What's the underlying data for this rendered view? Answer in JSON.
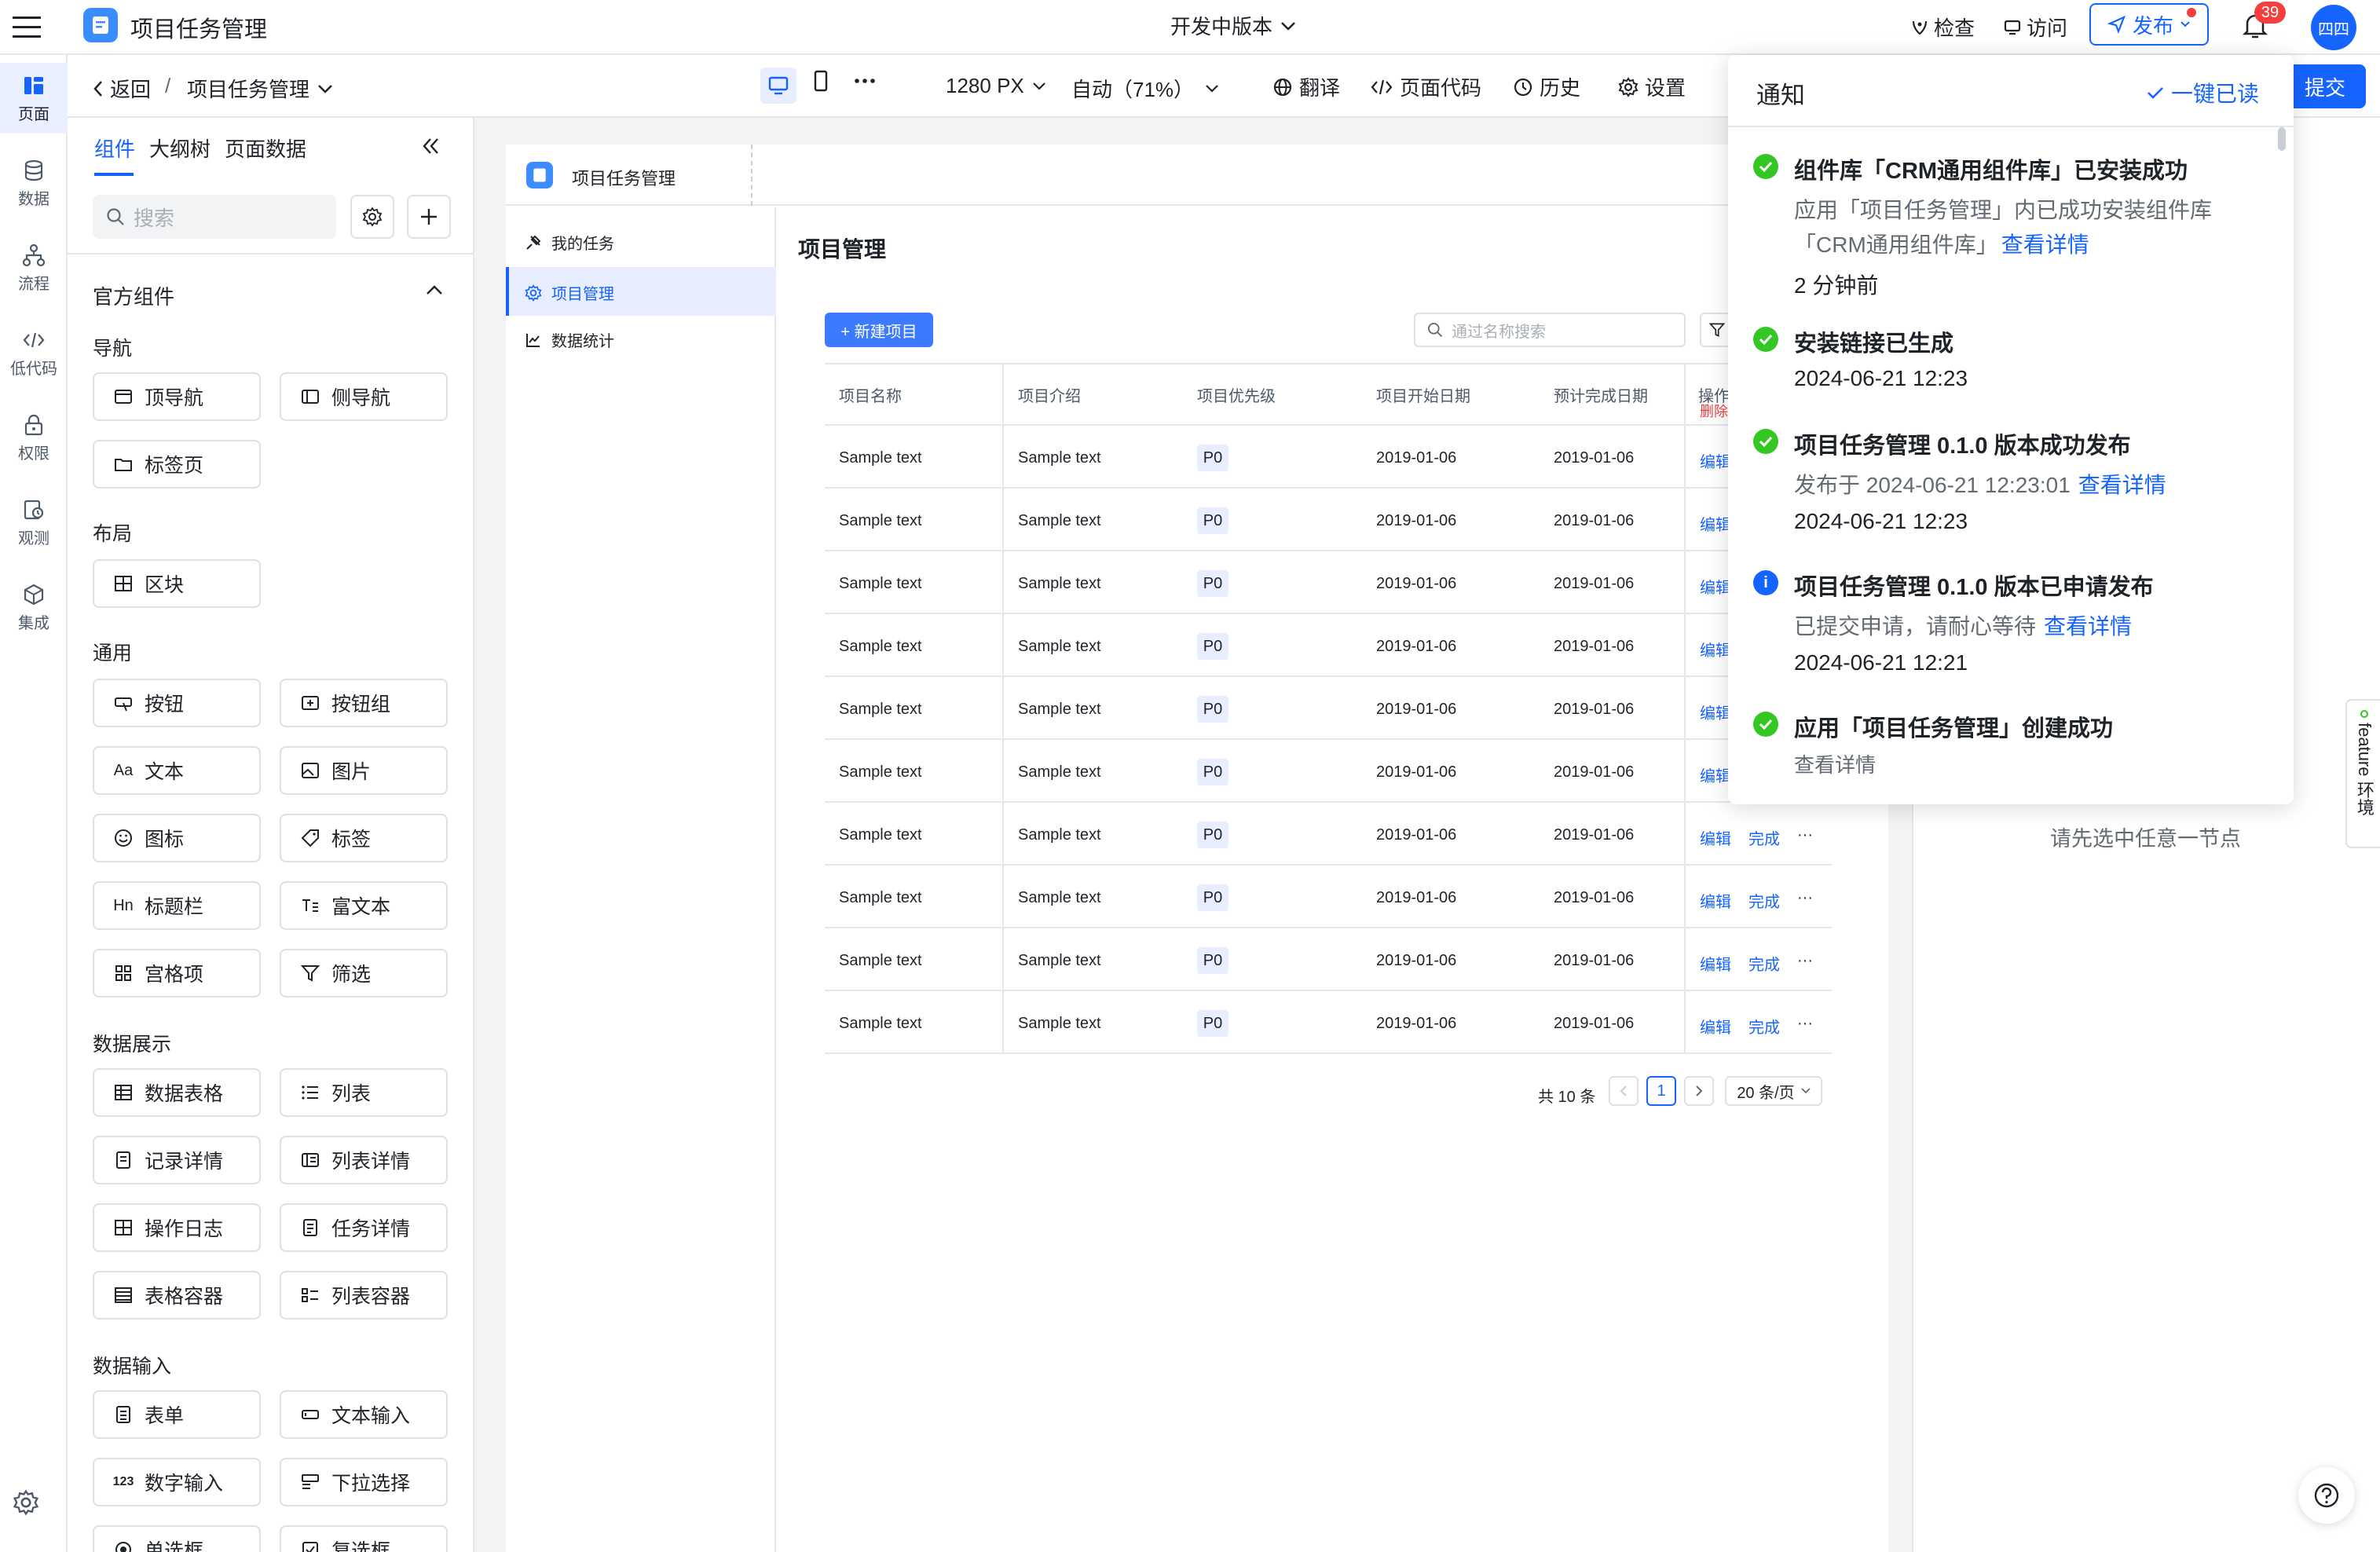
{
  "app": {
    "title": "项目任务管理",
    "version_label": "开发中版本",
    "check": "检查",
    "visit": "访问",
    "publish": "发布",
    "badge_count": "39",
    "avatar": "四四",
    "submit": "提交"
  },
  "toolbar": {
    "back": "返回",
    "page_name": "项目任务管理",
    "width": "1280 PX",
    "zoom": "自动（71%）",
    "translate": "翻译",
    "code": "页面代码",
    "history": "历史",
    "settings": "设置"
  },
  "rail": [
    {
      "label": "页面",
      "icon": "page-icon"
    },
    {
      "label": "数据",
      "icon": "database-icon"
    },
    {
      "label": "流程",
      "icon": "flow-icon"
    },
    {
      "label": "低代码",
      "icon": "code-icon"
    },
    {
      "label": "权限",
      "icon": "lock-icon"
    },
    {
      "label": "观测",
      "icon": "monitor-icon"
    },
    {
      "label": "集成",
      "icon": "integration-icon"
    }
  ],
  "panel": {
    "tabs": [
      "组件",
      "大纲树",
      "页面数据"
    ],
    "search_placeholder": "搜索",
    "group_title": "官方组件",
    "sections": {
      "nav": "导航",
      "layout": "布局",
      "general": "通用",
      "display": "数据展示",
      "input": "数据输入"
    },
    "components": {
      "top_nav": "顶导航",
      "side_nav": "侧导航",
      "tab_page": "标签页",
      "block": "区块",
      "button": "按钮",
      "button_group": "按钮组",
      "text": "文本",
      "image": "图片",
      "icon": "图标",
      "tag": "标签",
      "title_bar": "标题栏",
      "rich_text": "富文本",
      "grid_item": "宫格项",
      "filter": "筛选",
      "data_table": "数据表格",
      "list": "列表",
      "record_detail": "记录详情",
      "list_detail": "列表详情",
      "op_log": "操作日志",
      "task_detail": "任务详情",
      "table_container": "表格容器",
      "list_container": "列表容器",
      "form": "表单",
      "text_input": "文本输入",
      "number_input": "数字输入",
      "dropdown": "下拉选择",
      "radio": "单选框",
      "checkbox": "复选框"
    }
  },
  "preview": {
    "app_name": "项目任务管理",
    "menu": [
      "我的任务",
      "项目管理",
      "数据统计"
    ],
    "page_title": "项目管理",
    "new_button": "+ 新建项目",
    "search_placeholder": "通过名称搜索",
    "columns": [
      "项目名称",
      "项目介绍",
      "项目优先级",
      "项目开始日期",
      "预计完成日期",
      "操作"
    ],
    "row": {
      "name": "Sample text",
      "intro": "Sample text",
      "priority": "P0",
      "start": "2019-01-06",
      "end": "2019-01-06",
      "edit": "编辑",
      "done": "完成",
      "more": "···",
      "delete": "删除"
    },
    "total": "共 10 条",
    "page": "1",
    "page_size": "20 条/页"
  },
  "right_panel": {
    "empty_hint": "请先选中任意一节点",
    "feature_tab": "feature 环境"
  },
  "notifications": {
    "title": "通知",
    "mark_all": "一键已读",
    "items": [
      {
        "title": "组件库「CRM通用组件库」已安装成功",
        "line1": "应用「项目任务管理」内已成功安装组件库",
        "line2": "「CRM通用组件库」",
        "link": "查看详情",
        "time": "2 分钟前"
      },
      {
        "title": "安装链接已生成",
        "time": "2024-06-21 12:23"
      },
      {
        "title": "项目任务管理 0.1.0 版本成功发布",
        "line1": "发布于 2024-06-21 12:23:01",
        "link": "查看详情",
        "time": "2024-06-21 12:23"
      },
      {
        "title": "项目任务管理 0.1.0 版本已申请发布",
        "line1": "已提交申请，请耐心等待",
        "link": "查看详情",
        "time": "2024-06-21 12:21"
      },
      {
        "title": "应用「项目任务管理」创建成功",
        "link": "查看详情"
      }
    ]
  },
  "colors": {
    "accent": "#1664ff",
    "success": "#34c724",
    "badge": "#f53f3f"
  }
}
